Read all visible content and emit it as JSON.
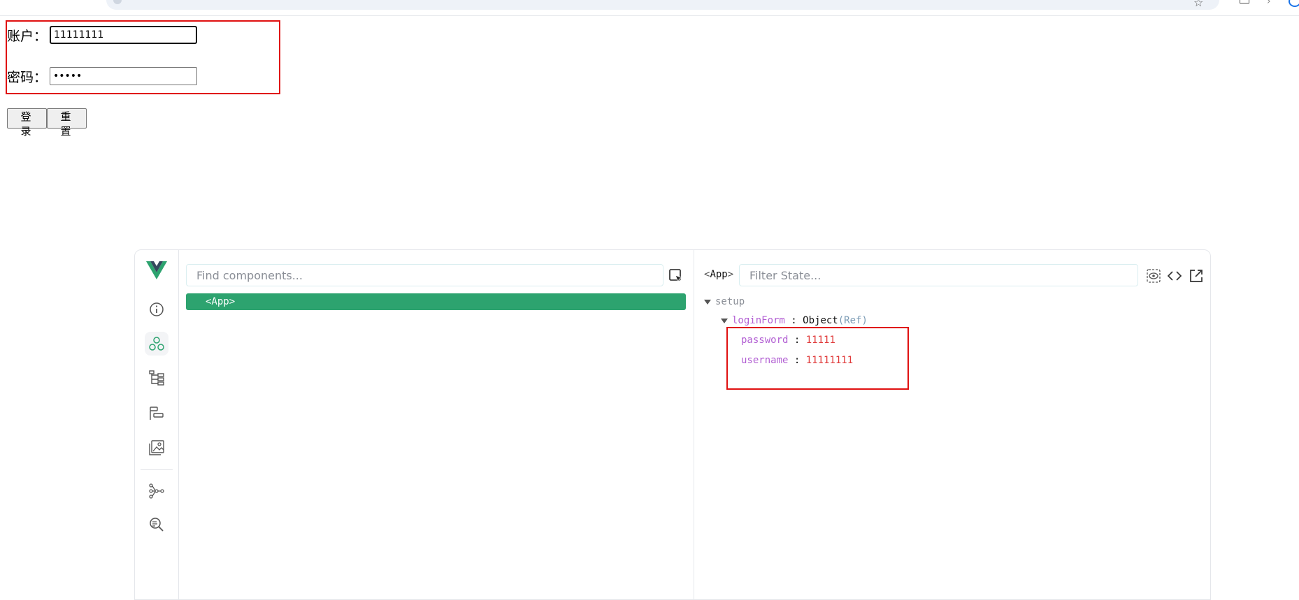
{
  "form": {
    "username_label": "账户：",
    "username_value": "11111111",
    "password_label": "密码：",
    "password_value": "11111",
    "login_button": "登 录",
    "reset_button": "重 置"
  },
  "devtools": {
    "find_placeholder": "Find components...",
    "tree": {
      "root_label": "<App>"
    },
    "inspector": {
      "component_name": "App",
      "filter_placeholder": "Filter State...",
      "setup_label": "setup",
      "state_name": "loginForm",
      "state_type": "Object",
      "state_kind": "(Ref)",
      "fields": [
        {
          "key": "password",
          "value": "11111"
        },
        {
          "key": "username",
          "value": "11111111"
        }
      ]
    },
    "sidebar_icons": [
      "vue-logo-icon",
      "info-icon",
      "components-icon",
      "component-tree-icon",
      "timeline-icon",
      "assets-icon",
      "graph-icon",
      "search-inspect-icon"
    ]
  },
  "colors": {
    "accent_green": "#2da36f",
    "highlight_red": "#e01010",
    "key_purple": "#b25fd3",
    "value_red": "#e03b3b"
  }
}
